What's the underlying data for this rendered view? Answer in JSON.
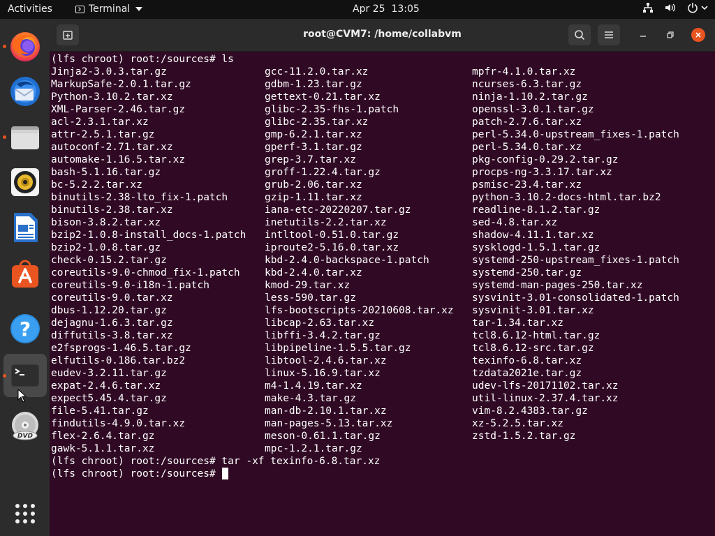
{
  "topbar": {
    "activities": "Activities",
    "app_name": "Terminal",
    "date": "Apr 25",
    "time": "13:05",
    "tray_icons": [
      "network-icon",
      "volume-icon",
      "power-icon",
      "chevron-down-icon"
    ]
  },
  "dock": {
    "items": [
      {
        "name": "firefox",
        "running": true
      },
      {
        "name": "thunderbird",
        "running": false
      },
      {
        "name": "files",
        "running": true
      },
      {
        "name": "rhythmbox",
        "running": false
      },
      {
        "name": "libreoffice-writer",
        "running": false
      },
      {
        "name": "ubuntu-software",
        "running": false
      },
      {
        "name": "help",
        "running": false
      },
      {
        "name": "terminal",
        "running": true,
        "active": true
      },
      {
        "name": "dvd",
        "running": false
      }
    ],
    "show_apps": "grid-icon"
  },
  "window": {
    "title": "root@CVM7: /home/collabvm"
  },
  "terminal": {
    "first_command": "(lfs chroot) root:/sources# ls",
    "col1": [
      "Jinja2-3.0.3.tar.gz",
      "MarkupSafe-2.0.1.tar.gz",
      "Python-3.10.2.tar.xz",
      "XML-Parser-2.46.tar.gz",
      "acl-2.3.1.tar.xz",
      "attr-2.5.1.tar.gz",
      "autoconf-2.71.tar.xz",
      "automake-1.16.5.tar.xz",
      "bash-5.1.16.tar.gz",
      "bc-5.2.2.tar.xz",
      "binutils-2.38-lto_fix-1.patch",
      "binutils-2.38.tar.xz",
      "bison-3.8.2.tar.xz",
      "bzip2-1.0.8-install_docs-1.patch",
      "bzip2-1.0.8.tar.gz",
      "check-0.15.2.tar.gz",
      "coreutils-9.0-chmod_fix-1.patch",
      "coreutils-9.0-i18n-1.patch",
      "coreutils-9.0.tar.xz",
      "dbus-1.12.20.tar.gz",
      "dejagnu-1.6.3.tar.gz",
      "diffutils-3.8.tar.xz",
      "e2fsprogs-1.46.5.tar.gz",
      "elfutils-0.186.tar.bz2",
      "eudev-3.2.11.tar.gz",
      "expat-2.4.6.tar.xz",
      "expect5.45.4.tar.gz",
      "file-5.41.tar.gz",
      "findutils-4.9.0.tar.xz",
      "flex-2.6.4.tar.gz",
      "gawk-5.1.1.tar.xz"
    ],
    "col2": [
      "gcc-11.2.0.tar.xz",
      "gdbm-1.23.tar.gz",
      "gettext-0.21.tar.xz",
      "glibc-2.35-fhs-1.patch",
      "glibc-2.35.tar.xz",
      "gmp-6.2.1.tar.xz",
      "gperf-3.1.tar.gz",
      "grep-3.7.tar.xz",
      "groff-1.22.4.tar.gz",
      "grub-2.06.tar.xz",
      "gzip-1.11.tar.xz",
      "iana-etc-20220207.tar.gz",
      "inetutils-2.2.tar.xz",
      "intltool-0.51.0.tar.gz",
      "iproute2-5.16.0.tar.xz",
      "kbd-2.4.0-backspace-1.patch",
      "kbd-2.4.0.tar.xz",
      "kmod-29.tar.xz",
      "less-590.tar.gz",
      "lfs-bootscripts-20210608.tar.xz",
      "libcap-2.63.tar.xz",
      "libffi-3.4.2.tar.gz",
      "libpipeline-1.5.5.tar.gz",
      "libtool-2.4.6.tar.xz",
      "linux-5.16.9.tar.xz",
      "m4-1.4.19.tar.xz",
      "make-4.3.tar.gz",
      "man-db-2.10.1.tar.xz",
      "man-pages-5.13.tar.xz",
      "meson-0.61.1.tar.gz",
      "mpc-1.2.1.tar.gz"
    ],
    "col3": [
      "mpfr-4.1.0.tar.xz",
      "ncurses-6.3.tar.gz",
      "ninja-1.10.2.tar.gz",
      "openssl-3.0.1.tar.gz",
      "patch-2.7.6.tar.xz",
      "perl-5.34.0-upstream_fixes-1.patch",
      "perl-5.34.0.tar.xz",
      "pkg-config-0.29.2.tar.gz",
      "procps-ng-3.3.17.tar.xz",
      "psmisc-23.4.tar.xz",
      "python-3.10.2-docs-html.tar.bz2",
      "readline-8.1.2.tar.gz",
      "sed-4.8.tar.xz",
      "shadow-4.11.1.tar.xz",
      "sysklogd-1.5.1.tar.gz",
      "systemd-250-upstream_fixes-1.patch",
      "systemd-250.tar.gz",
      "systemd-man-pages-250.tar.xz",
      "sysvinit-3.01-consolidated-1.patch",
      "sysvinit-3.01.tar.xz",
      "tar-1.34.tar.xz",
      "tcl8.6.12-html.tar.gz",
      "tcl8.6.12-src.tar.gz",
      "texinfo-6.8.tar.xz",
      "tzdata2021e.tar.gz",
      "udev-lfs-20171102.tar.xz",
      "util-linux-2.37.4.tar.xz",
      "vim-8.2.4383.tar.gz",
      "xz-5.2.5.tar.xz",
      "zstd-1.5.2.tar.gz"
    ],
    "second_command": "(lfs chroot) root:/sources# tar -xf texinfo-6.8.tar.xz",
    "prompt": "(lfs chroot) root:/sources# "
  }
}
